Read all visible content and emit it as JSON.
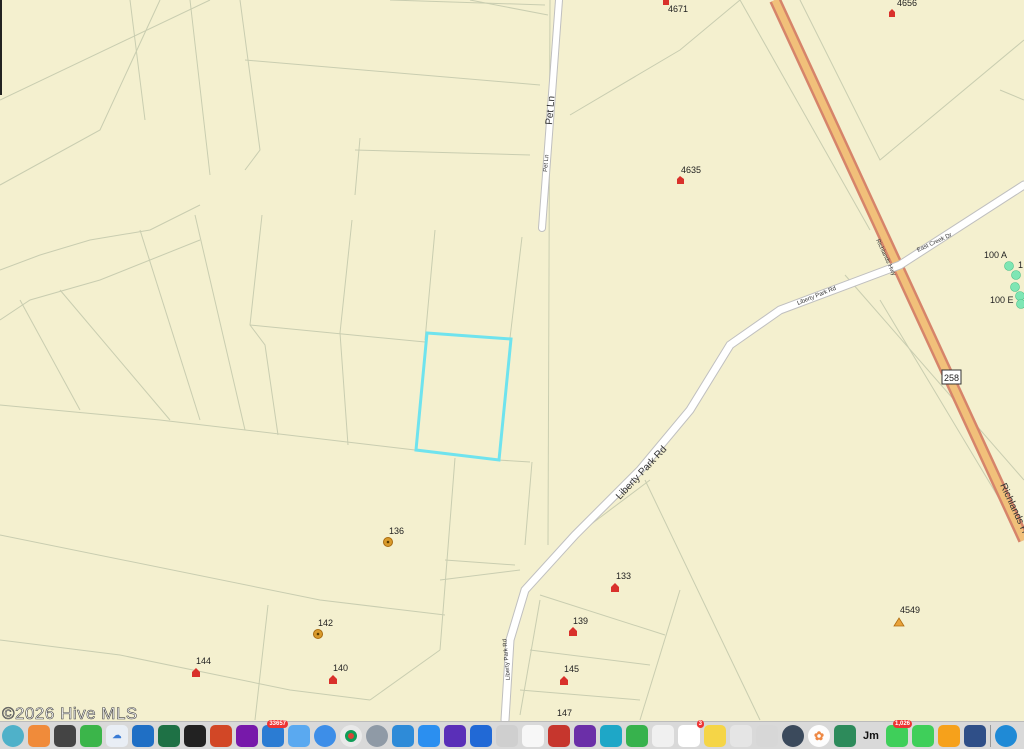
{
  "map": {
    "roads": {
      "pet_ln": "Pet Ln",
      "pet_ln_small": "Pet Ln",
      "liberty_park_rd": "Liberty Park Rd",
      "liberty_park_rd_small": "Liberty Park Rd",
      "liberty_park_rd_south": "Liberty Park Rd",
      "richlands": "Richlands H",
      "richlands_small": "Richlands Hwy",
      "east_creek": "East Creek Dr",
      "us_shield": "258"
    },
    "addresses": {
      "a4671": "4671",
      "a4656": "4656",
      "a4635": "4635",
      "a136": "136",
      "a142": "142",
      "a144": "144",
      "a140": "140",
      "a133": "133",
      "a139": "139",
      "a145": "145",
      "a147": "147",
      "a4549": "4549",
      "a100a": "100 A",
      "a100e": "100 E",
      "a1": "1"
    },
    "highlight_color": "#6fe3ee",
    "marker_color": "#d9312b",
    "copyright": "©2026 Hive MLS"
  },
  "dock": {
    "badges": {
      "mail": "33657",
      "reminders": "3",
      "messages": "1,026"
    },
    "icons": [
      "finder-icon",
      "launchpad-icon",
      "calculator-icon",
      "numbers-icon",
      "icloud-icon",
      "outlook-icon",
      "excel-icon",
      "music-icon",
      "powerpoint-icon",
      "onenote-icon",
      "mail-icon",
      "mail-app-icon",
      "safari-icon",
      "chrome-icon",
      "settings-icon",
      "preview-icon",
      "appstore-icon",
      "imovie-icon",
      "flashcard-icon",
      "cut-icon",
      "sketch-icon",
      "affinity-icon",
      "affinity-photo-icon",
      "affinity-designer-icon",
      "sheets-icon",
      "ccleaner-icon",
      "reminders-icon",
      "notes-icon",
      "finder2-icon",
      "screenshot-icon",
      "zoom-icon",
      "photos-icon",
      "vpn-icon",
      "jm-icon",
      "messages-icon",
      "facetime-icon",
      "home-icon",
      "scan-icon",
      "quicktime-icon"
    ]
  }
}
